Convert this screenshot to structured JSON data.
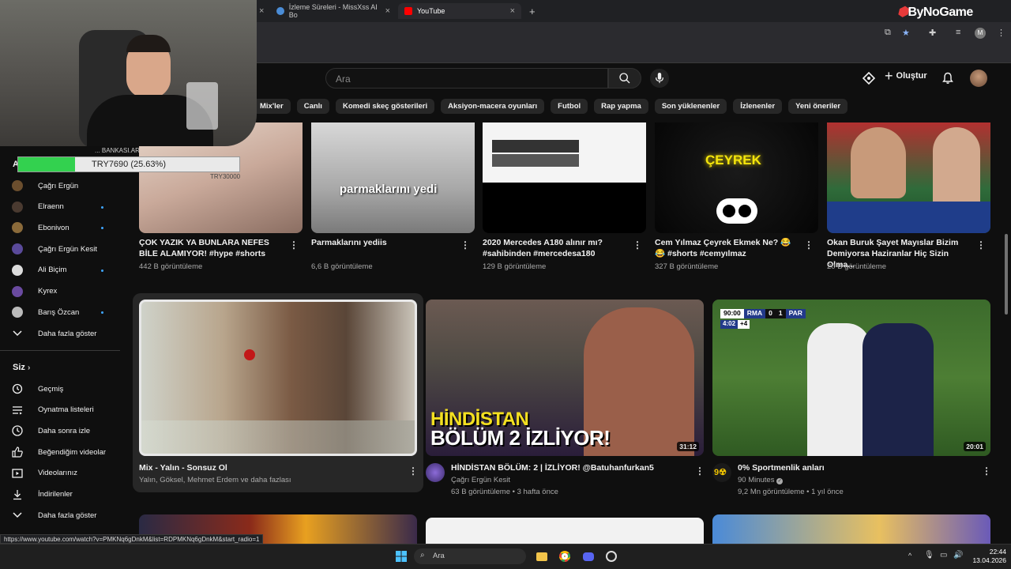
{
  "browser": {
    "tabs": [
      {
        "label": "İzleme Süreleri - MissXss AI Bo"
      },
      {
        "label": "YouTube"
      }
    ],
    "new_tab": "+",
    "brand_overlay": {
      "part1": "By",
      "part2": "NoGame"
    },
    "status_url": "https://www.youtube.com/watch?v=PMKNq6gDnkM&list=RDPMKNq6gDnkM&start_radio=1"
  },
  "stream_overlay": {
    "donation_progress_text": "TRY7690 (25.63%)",
    "donation_progress_pct": 25.63,
    "donation_header": "... BANKASI.AR"
  },
  "header": {
    "search_placeholder": "Ara",
    "create_label": "Oluştur"
  },
  "chips": [
    "Mix'ler",
    "Canlı",
    "Komedi skeç gösterileri",
    "Aksiyon-macera oyunları",
    "Futbol",
    "Rap yapma",
    "Son yüklenenler",
    "İzlenenler",
    "Yeni öneriler"
  ],
  "sidebar": {
    "subscriptions_letter": "A",
    "subscriptions": [
      {
        "label": "Çağrı Ergün",
        "dot": false,
        "color": "#6b4e2e"
      },
      {
        "label": "Elraenn",
        "dot": true,
        "color": "#4a3a30"
      },
      {
        "label": "Ebonivon",
        "dot": true,
        "color": "#8a6a3a"
      },
      {
        "label": "Çağrı Ergün Kesit",
        "dot": false,
        "color": "#5a4a9a"
      },
      {
        "label": "Ali Biçim",
        "dot": true,
        "color": "#dcdcdc"
      },
      {
        "label": "Kyrex",
        "dot": false,
        "color": "#6a4aa0"
      },
      {
        "label": "Barış Özcan",
        "dot": true,
        "color": "#bbbbbb"
      }
    ],
    "show_more_1": "Daha fazla göster",
    "you_title": "Siz",
    "you_items": [
      {
        "label": "Geçmiş",
        "icon": "history-icon"
      },
      {
        "label": "Oynatma listeleri",
        "icon": "playlist-icon"
      },
      {
        "label": "Daha sonra izle",
        "icon": "clock-icon"
      },
      {
        "label": "Beğendiğim videolar",
        "icon": "thumbs-up-icon"
      },
      {
        "label": "Videolarınız",
        "icon": "video-icon"
      },
      {
        "label": "İndirilenler",
        "icon": "download-icon"
      }
    ],
    "show_more_2": "Daha fazla göster"
  },
  "shorts": [
    {
      "title": "ÇOK YAZIK YA BUNLARA NEFES BİLE ALAMIYOR! #hype #shorts",
      "views": "442 B görüntüleme",
      "thumb_text": "TRY30000"
    },
    {
      "title": "Parmaklarını yediis",
      "views": "6,6 B görüntüleme",
      "thumb_text": "parmaklarını yedi"
    },
    {
      "title": "2020 Mercedes A180 alınır mı? #sahibinden #mercedesa180",
      "views": "129 B görüntüleme",
      "thumb_text": ""
    },
    {
      "title": "Cem Yılmaz Çeyrek Ekmek Ne? 😂 😂 #shorts #cemyılmaz",
      "views": "327 B görüntüleme",
      "thumb_text": "ÇEYREK"
    },
    {
      "title": "Okan Buruk Şayet Mayıslar Bizim Demiyorsa Haziranlar Hiç Sizin Olma...",
      "views": "20 B görüntüleme",
      "thumb_text": ""
    }
  ],
  "videos": [
    {
      "title": "Mix - Yalın - Sonsuz Ol",
      "line2": "Yalın, Göksel, Mehmet Erdem ve daha fazlası",
      "line3": "",
      "duration": ""
    },
    {
      "title": "HİNDİSTAN BÖLÜM: 2 | İZLİYOR! @Batuhanfurkan5",
      "line2": "Çağrı Ergün Kesit",
      "line3": "63 B görüntüleme • 3 hafta önce",
      "duration": "31:12",
      "thumb_text1": "HİNDİSTAN",
      "thumb_text2": "BÖLÜM 2 İZLİYOR!"
    },
    {
      "title": "0% Sportmenlik anları",
      "line2": "90 Minutes",
      "line3": "9,2 Mn görüntüleme • 1 yıl önce",
      "duration": "20:01",
      "scoreboard": {
        "time": "90:00",
        "home": "RMA",
        "home_score": "0",
        "away_score": "1",
        "away": "PAR",
        "added": "4:02",
        "plus": "+4"
      }
    }
  ],
  "taskbar": {
    "search_label": "Ara",
    "time": "22:44",
    "date": "13.04.2026"
  }
}
